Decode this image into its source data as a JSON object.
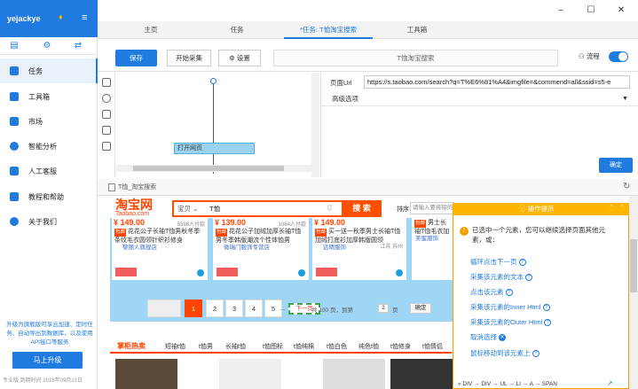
{
  "app": {
    "user": "yejackye",
    "version_text": "专业版 到期时间 2018年09月21日",
    "promo_text": "升级为旗舰版可享云加速、定时任务、自动导出到数据库，以及使用API接口等服务",
    "upgrade_label": "马上升级",
    "accent": "#1f7be0"
  },
  "sidebar": {
    "items": [
      {
        "label": "任务"
      },
      {
        "label": "工具箱"
      },
      {
        "label": "市场"
      },
      {
        "label": "智能分析"
      },
      {
        "label": "人工客服"
      },
      {
        "label": "教程和帮助"
      },
      {
        "label": "关于我们"
      }
    ]
  },
  "tabs": [
    {
      "label": "主页"
    },
    {
      "label": "任务"
    },
    {
      "label": "*任务: T恤淘宝搜索"
    },
    {
      "label": "工具箱"
    }
  ],
  "toolbar": {
    "save_label": "保存",
    "start_label": "开始采集",
    "settings_label": "设置",
    "task_title": "T恤淘宝搜索",
    "flow_label": "流程"
  },
  "flow": {
    "node_label": "打开网页"
  },
  "panel": {
    "url_label": "页面Url",
    "url_value": "https://s.taobao.com/search?q=T%E6%81%A4&imgfile=&commend=all&ssid=s5-e",
    "advanced_label": "高级选项",
    "ok_label": "确定"
  },
  "browser": {
    "tab_title": "T恤_淘宝搜索",
    "logo": "淘宝网",
    "logo_sub": "Taobao.com",
    "search_category": "宝贝",
    "search_value": "T恤",
    "search_button": "搜 索",
    "sort_label": "排序",
    "sort_placeholder": "请输入要排除的词",
    "products": [
      {
        "price": "¥ 149.00",
        "sales": "5598人付款",
        "badge": "包邮",
        "title": "花花公子长袖T恤男秋冬季条纹毛衣圆领针织衫修身",
        "shop": "黎丽人旗舰店",
        "loc": ""
      },
      {
        "price": "¥ 139.00",
        "sales": "1084人付款",
        "badge": "包邮",
        "title": "花花公子加绒加厚长袖T恤男冬季韩版潮流个性体恤男",
        "shop": "微瑞门服饰专营店",
        "loc": ""
      },
      {
        "price": "¥ 149.00",
        "sales": "",
        "badge": "包邮",
        "title": "买一送一秋季男士长袖T恤加绒打底衫加厚韩版圆领",
        "shop": "远晴服饰",
        "loc": "江苏 苏州"
      },
      {
        "price": "",
        "sales": "",
        "badge": "包邮",
        "title": "男士长袖T恤毛衣加绒加厚",
        "shop": "美蜜服饰",
        "loc": ""
      }
    ],
    "pager": {
      "pages": [
        "1",
        "2",
        "3",
        "4",
        "5",
        "..."
      ],
      "current": "1",
      "next_label": "下一页",
      "info": "共 100 页，到第",
      "page_input": "2",
      "unit": "页",
      "ok_label": "确定"
    },
    "category_title": "掌柜热卖",
    "categories": [
      "短袖t恤",
      "t恤男",
      "长袖t恤",
      "t恤图标",
      "t恤纯棉",
      "t恤白色",
      "纯色t恤",
      "t恤修身",
      "t恤情侣"
    ]
  },
  "operation": {
    "title": "操作提示",
    "message": "已选中一个元素，您可以继续选择页面其他元素，或：",
    "actions": [
      {
        "label": "循环点击下一页"
      },
      {
        "label": "采集该元素的文本"
      },
      {
        "label": "点击该元素"
      },
      {
        "label": "采集该元素的Inner Html"
      },
      {
        "label": "采集该元素的Outer Html"
      },
      {
        "label": "取消选择"
      },
      {
        "label": "鼠标移动到该元素上"
      }
    ],
    "path": "« DIV → DIV → UL → LI → A → SPAN"
  }
}
